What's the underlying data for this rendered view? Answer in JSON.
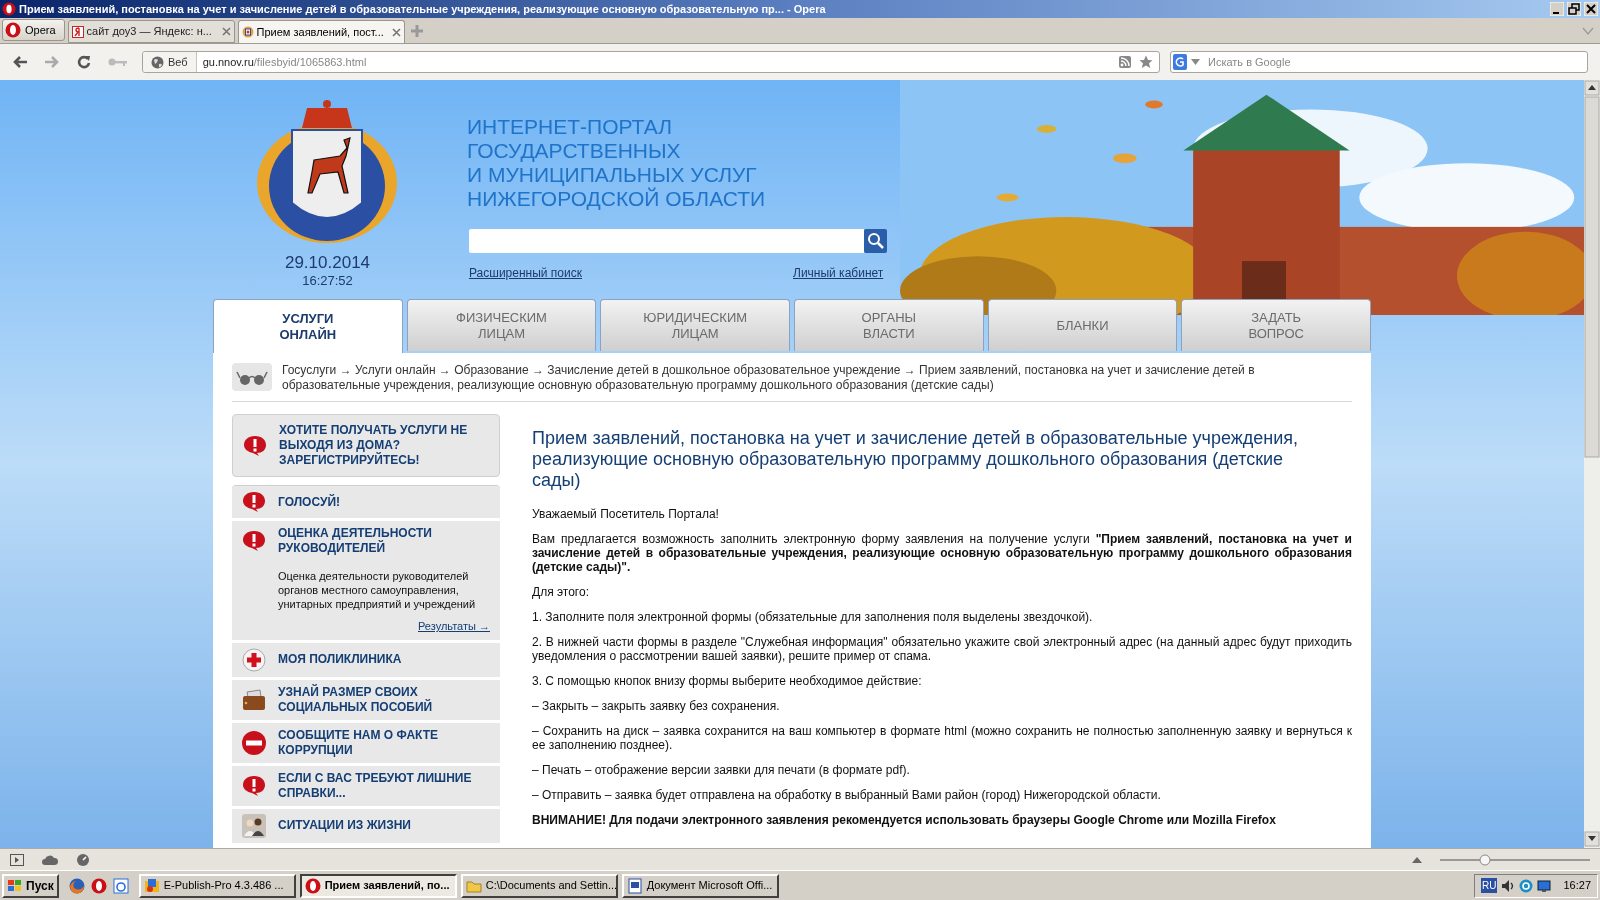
{
  "window": {
    "title": "Прием заявлений, постановка на учет и зачисление детей в образовательные учреждения, реализующие основную образовательную пр... - Opera"
  },
  "browser": {
    "menu_button": "Opera",
    "tabs": [
      {
        "label": "сайт доу3 — Яндекс: н...",
        "selected": false
      },
      {
        "label": "Прием заявлений, пост...",
        "selected": true
      }
    ],
    "address": {
      "mode": "Веб",
      "host": "gu.nnov.ru",
      "path": "/filesbyid/1065863.html"
    },
    "search": {
      "placeholder": "Искать в Google"
    }
  },
  "header": {
    "title_lines": [
      "ИНТЕРНЕТ-ПОРТАЛ",
      "ГОСУДАРСТВЕННЫХ",
      "И МУНИЦИПАЛЬНЫХ УСЛУГ",
      "НИЖЕГОРОДСКОЙ ОБЛАСТИ"
    ],
    "date": "29.10.2014",
    "time": "16:27:52",
    "advanced_search": "Расширенный поиск",
    "cabinet": "Личный кабинет"
  },
  "nav_tabs": [
    {
      "lines": [
        "УСЛУГИ",
        "ОНЛАЙН"
      ],
      "selected": true
    },
    {
      "lines": [
        "ФИЗИЧЕСКИМ",
        "ЛИЦАМ"
      ],
      "selected": false
    },
    {
      "lines": [
        "ЮРИДИЧЕСКИМ",
        "ЛИЦАМ"
      ],
      "selected": false
    },
    {
      "lines": [
        "ОРГАНЫ",
        "ВЛАСТИ"
      ],
      "selected": false
    },
    {
      "lines": [
        "БЛАНКИ"
      ],
      "selected": false
    },
    {
      "lines": [
        "ЗАДАТЬ",
        "ВОПРОС"
      ],
      "selected": false
    }
  ],
  "breadcrumb": "Госуслуги → Услуги онлайн → Образование → Зачисление детей в дошкольное образовательное учреждение → Прием заявлений, постановка на учет и зачисление детей в образовательные учреждения, реализующие основную образовательную программу дошкольного образования (детские сады)",
  "sidebar": {
    "promo": {
      "kind": "alert",
      "title": "ХОТИТЕ ПОЛУЧАТЬ УСЛУГИ НЕ ВЫХОДЯ ИЗ ДОМА? ЗАРЕГИСТРИРУЙТЕСЬ!"
    },
    "items": [
      {
        "kind": "alert",
        "title": "ГОЛОСУЙ!"
      },
      {
        "kind": "alert",
        "title": "ОЦЕНКА ДЕЯТЕЛЬНОСТИ РУКОВОДИТЕЛЕЙ",
        "description": "Оценка деятельности руководителей органов местного самоуправления, унитарных предприятий и учреждений",
        "link": "Результаты →"
      },
      {
        "kind": "cross",
        "title": "МОЯ ПОЛИКЛИНИКА"
      },
      {
        "kind": "wallet",
        "title": "УЗНАЙ РАЗМЕР СВОИХ СОЦИАЛЬНЫХ ПОСОБИЙ"
      },
      {
        "kind": "stop",
        "title": "СООБЩИТЕ НАМ О ФАКТЕ КОРРУПЦИИ"
      },
      {
        "kind": "alert",
        "title": "ЕСЛИ С ВАС ТРЕБУЮТ ЛИШНИЕ СПРАВКИ..."
      },
      {
        "kind": "people",
        "title": "СИТУАЦИИ ИЗ ЖИЗНИ"
      }
    ]
  },
  "article": {
    "heading": "Прием заявлений, постановка на учет и зачисление детей в образовательные учреждения, реализующие основную образовательную программу дошкольного образования (детские сады)",
    "paragraphs": [
      "Уважаемый Посетитель Портала!",
      "Вам предлагается возможность заполнить электронную форму заявления на получение услуги **\"Прием заявлений, постановка на учет и зачисление детей в образовательные учреждения, реализующие основную образовательную программу дошкольного образования (детские сады)\".**",
      "Для этого:",
      "1. Заполните поля электронной формы (обязательные для заполнения поля выделены звездочкой).",
      "2. В нижней части формы в разделе \"Служебная информация\" обязательно укажите свой электронный адрес (на данный адрес будут приходить уведомления о рассмотрении вашей заявки), решите пример от спама.",
      "3. С помощью кнопок внизу формы выберите необходимое действие:",
      "– Закрыть – закрыть заявку без сохранения.",
      "– Сохранить на диск – заявка сохранится на ваш компьютер в формате html (можно сохранить не полностью заполненную заявку и вернуться к ее заполнению позднее).",
      "– Печать – отображение версии заявки для печати (в формате pdf).",
      "– Отправить – заявка будет отправлена на обработку в выбранный Вами район (город) Нижегородской области."
    ],
    "notice": "ВНИМАНИЕ! Для подачи электронного заявления рекомендуется использовать браузеры Google Chrome или Mozilla Firefox"
  },
  "taskbar": {
    "start": "Пуск",
    "tasks": [
      {
        "label": "E-Publish-Pro 4.3.486 ...",
        "selected": false,
        "kind": "app"
      },
      {
        "label": "Прием заявлений, по...",
        "selected": true,
        "kind": "browser"
      },
      {
        "label": "C:\\Documents and Settin...",
        "selected": false,
        "kind": "folder"
      },
      {
        "label": "Документ Microsoft Offi...",
        "selected": false,
        "kind": "document"
      }
    ],
    "language": "RU",
    "clock": "16:27"
  }
}
